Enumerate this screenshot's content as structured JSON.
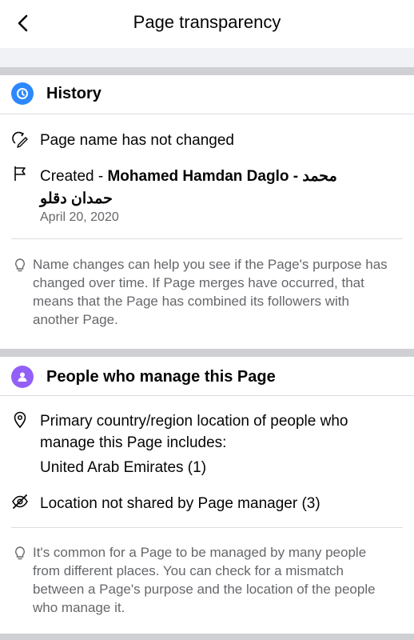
{
  "header": {
    "title": "Page transparency",
    "back_icon": "chevron-left-icon"
  },
  "history": {
    "title": "History",
    "icon_color": "#2d88ff",
    "name_status": "Page name has not changed",
    "created_prefix": "Created - ",
    "created_name_line1": "Mohamed Hamdan Daglo - محمد",
    "created_name_line2": "حمدان دقلو",
    "created_date": "April 20, 2020",
    "note": "Name changes can help you see if the Page's purpose has changed over time. If Page merges have occurred, that means that the Page has combined its followers with another Page."
  },
  "managers": {
    "title": "People who manage this Page",
    "icon_color": "#9360f7",
    "location_intro": "Primary country/region location of people who manage this Page includes:",
    "country": "United Arab Emirates (1)",
    "not_shared": "Location not shared by Page manager (3)",
    "note": "It's common for a Page to be managed by many people from different places. You can check for a mismatch between a Page's purpose and the location of the people who manage it."
  }
}
